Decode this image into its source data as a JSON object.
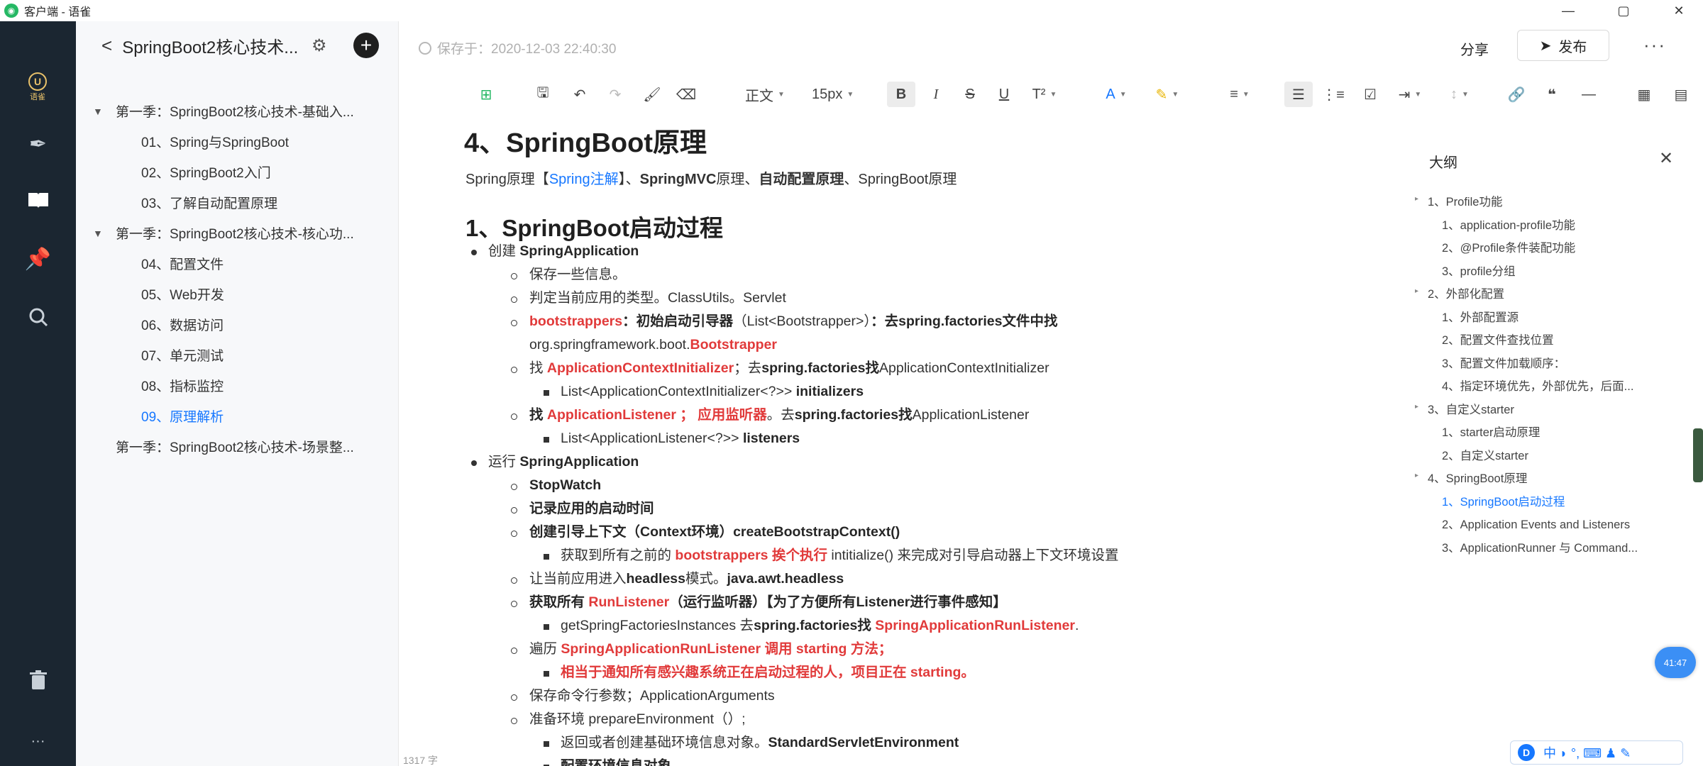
{
  "window": {
    "title": "客户端 - 语雀",
    "minimize": "—",
    "maximize": "▢",
    "close": "✕"
  },
  "rail": {
    "brand_letter": "U",
    "brand_text": "语雀"
  },
  "sidebar": {
    "back": "<",
    "title": "SpringBoot2核心技术...",
    "add": "+",
    "items": [
      {
        "label": "第一季：SpringBoot2核心技术-基础入...",
        "level": 0,
        "expanded": true
      },
      {
        "label": "01、Spring与SpringBoot",
        "level": 1
      },
      {
        "label": "02、SpringBoot2入门",
        "level": 1
      },
      {
        "label": "03、了解自动配置原理",
        "level": 1
      },
      {
        "label": "第一季：SpringBoot2核心技术-核心功...",
        "level": 0,
        "expanded": true
      },
      {
        "label": "04、配置文件",
        "level": 1
      },
      {
        "label": "05、Web开发",
        "level": 1
      },
      {
        "label": "06、数据访问",
        "level": 1
      },
      {
        "label": "07、单元测试",
        "level": 1
      },
      {
        "label": "08、指标监控",
        "level": 1
      },
      {
        "label": "09、原理解析",
        "level": 1,
        "active": true
      },
      {
        "label": "第一季：SpringBoot2核心技术-场景整...",
        "level": 0
      }
    ]
  },
  "header": {
    "save_status": "保存于：2020-12-03 22:40:30",
    "share": "分享",
    "publish": "发布",
    "more": "···"
  },
  "toolbar": {
    "paragraph_style": "正文",
    "font_size": "15px",
    "bold": "B",
    "italic": "I",
    "strike": "S",
    "underline": "U"
  },
  "doc": {
    "top_heading": "4、SpringBoot原理",
    "subline": {
      "a": "Spring原理【",
      "link": "Spring注解",
      "b": "】、",
      "c": "SpringMVC",
      "d": "原理、",
      "e": "自动配置原理",
      "f": "、SpringBoot原理"
    },
    "h1": "1、SpringBoot启动过程",
    "lines": {
      "l1a": "创建 ",
      "l1b": "SpringApplication",
      "l2": "保存一些信息。",
      "l3": "判定当前应用的类型。ClassUtils。Servlet",
      "l4a": "bootstrappers",
      "l4b": "：初始启动引导器",
      "l4c": "（List<Bootstrapper>）",
      "l4d": "：去spring.factories文件中找",
      "l5a": "org.springframework.boot.",
      "l5b": "Bootstrapper",
      "l6a": "找 ",
      "l6b": "ApplicationContextInitializer",
      "l6c": "；去",
      "l6d": "spring.factories找",
      "l6e": "ApplicationContextInitializer",
      "l7a": "List<ApplicationContextInitializer<?>> ",
      "l7b": "initializers",
      "l8a": "找 ",
      "l8b": "ApplicationListener ； 应用监听器",
      "l8c": "。去",
      "l8d": "spring.factories找",
      "l8e": "ApplicationListener",
      "l9a": "List<ApplicationListener<?>> ",
      "l9b": "listeners",
      "l10a": "运行 ",
      "l10b": "SpringApplication",
      "l11": "StopWatch",
      "l12": "记录应用的启动时间",
      "l13": "创建引导上下文（Context环境）createBootstrapContext()",
      "l14a": "获取到所有之前的 ",
      "l14b": "bootstrappers 挨个执行",
      "l14c": " intitialize() 来完成对引导启动器上下文环境设置",
      "l15a": "让当前应用进入",
      "l15b": "headless",
      "l15c": "模式。",
      "l15d": "java.awt.headless",
      "l16a": "获取所有 ",
      "l16b": "RunListener",
      "l16c": "（运行监听器）【为了方便所有Listener进行事件感知】",
      "l17a": "getSpringFactoriesInstances 去",
      "l17b": "spring.factories找 ",
      "l17c": "SpringApplicationRunListener",
      "l17d": ".",
      "l18a": "遍历 ",
      "l18b": "SpringApplicationRunListener 调用 starting 方法；",
      "l19": "相当于通知所有感兴趣系统正在启动过程的人，项目正在 starting。",
      "l20": "保存命令行参数；ApplicationArguments",
      "l21": "准备环境 prepareEnvironment（）;",
      "l22a": "返回或者创建基础环境信息对象。",
      "l22b": "StandardServletEnvironment",
      "l23": "配置环境信息对象。"
    },
    "word_count": "1317 字"
  },
  "outline": {
    "title": "大纲",
    "close": "✕",
    "items": [
      {
        "label": "1、Profile功能",
        "level": 0
      },
      {
        "label": "1、application-profile功能",
        "level": 1
      },
      {
        "label": "2、@Profile条件装配功能",
        "level": 1
      },
      {
        "label": "3、profile分组",
        "level": 1
      },
      {
        "label": "2、外部化配置",
        "level": 0
      },
      {
        "label": "1、外部配置源",
        "level": 1
      },
      {
        "label": "2、配置文件查找位置",
        "level": 1
      },
      {
        "label": "3、配置文件加载顺序：",
        "level": 1
      },
      {
        "label": "4、指定环境优先，外部优先，后面...",
        "level": 1
      },
      {
        "label": "3、自定义starter",
        "level": 0
      },
      {
        "label": "1、starter启动原理",
        "level": 1
      },
      {
        "label": "2、自定义starter",
        "level": 1
      },
      {
        "label": "4、SpringBoot原理",
        "level": 0
      },
      {
        "label": "1、SpringBoot启动过程",
        "level": 1,
        "active": true
      },
      {
        "label": "2、Application Events and Listeners",
        "level": 1
      },
      {
        "label": "3、ApplicationRunner 与 Command...",
        "level": 1
      }
    ]
  },
  "overlay": {
    "timer": "41:47",
    "ime_logo": "D",
    "ime_text": "中 ◗ °, ⌨ ♟ ✎"
  },
  "colors": {
    "accent": "#1677ff",
    "red_text": "#e13a3a",
    "rail_bg": "#1b2631",
    "sidebar_bg": "#f7f8fa"
  }
}
